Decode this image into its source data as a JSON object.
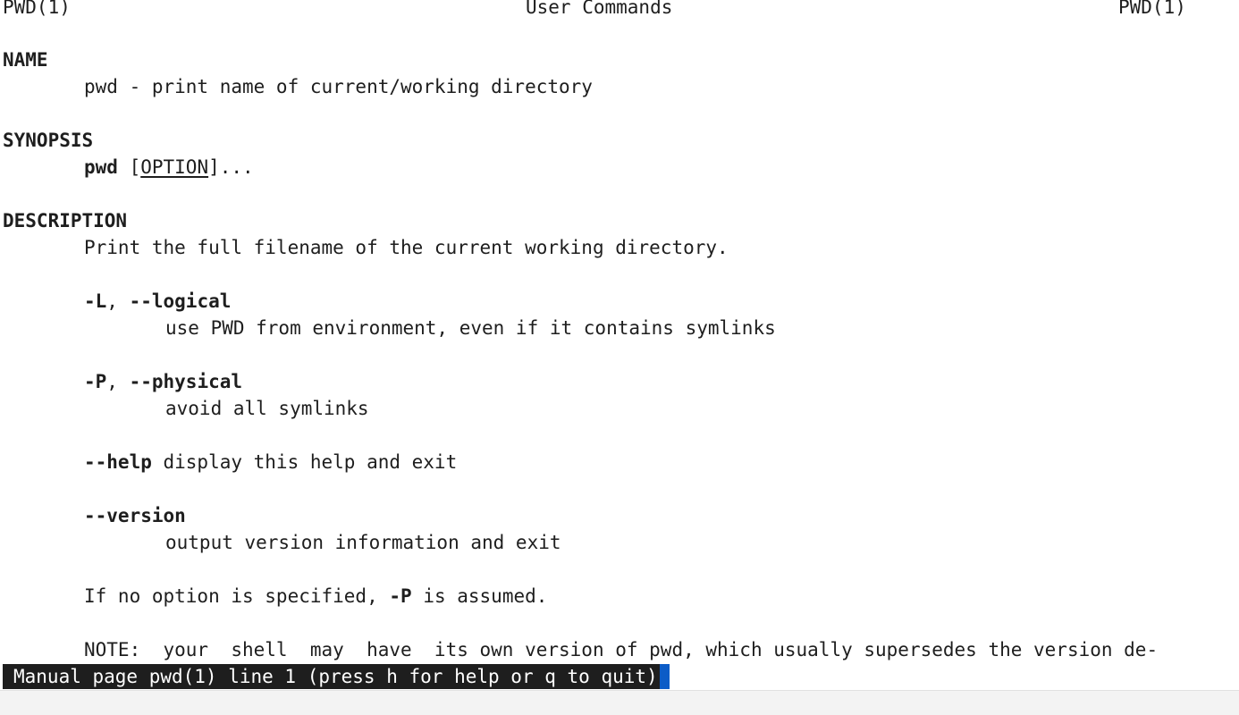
{
  "header": {
    "left": "PWD(1)",
    "center": "User Commands",
    "right": "PWD(1)"
  },
  "sections": {
    "name": {
      "heading": "NAME",
      "text": "pwd - print name of current/working directory"
    },
    "synopsis": {
      "heading": "SYNOPSIS",
      "command": "pwd",
      "bracket_open": " [",
      "option": "OPTION",
      "bracket_close": "]..."
    },
    "description": {
      "heading": "DESCRIPTION",
      "intro": "Print the full filename of the current working directory.",
      "opt_logical_flag": "-L",
      "opt_logical_sep": ", ",
      "opt_logical_long": "--logical",
      "opt_logical_desc": "use PWD from environment, even if it contains symlinks",
      "opt_physical_flag": "-P",
      "opt_physical_sep": ", ",
      "opt_physical_long": "--physical",
      "opt_physical_desc": "avoid all symlinks",
      "opt_help_flag": "--help",
      "opt_help_desc": " display this help and exit",
      "opt_version_flag": "--version",
      "opt_version_desc": "output version information and exit",
      "default_pre": "If no option is specified, ",
      "default_flag": "-P",
      "default_post": " is assumed.",
      "note": "NOTE:  your  shell  may  have  its own version of pwd, which usually supersedes the version de-"
    }
  },
  "status": {
    "text": "Manual page pwd(1) line 1 (press h for help or q to quit)",
    "cursor_color": "#0c5cc7"
  }
}
